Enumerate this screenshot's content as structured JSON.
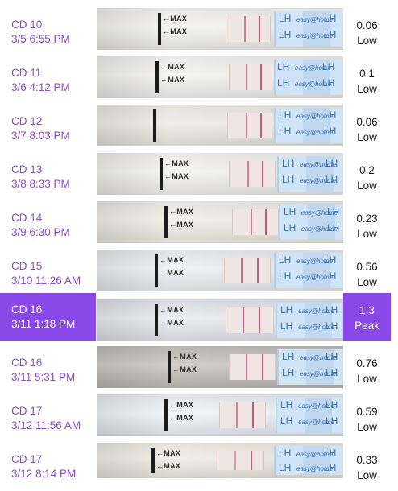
{
  "strip_text": {
    "max": "←MAX",
    "lh": "LH",
    "brand": "easy@home"
  },
  "colors": {
    "label": "#8a4fc4",
    "peak_highlight": "#8a48e8",
    "value": "#1d1d1d"
  },
  "readings": [
    {
      "cd": "CD 10",
      "datetime": "3/5 6:55 PM",
      "value": "0.06",
      "level": "Low"
    },
    {
      "cd": "CD 11",
      "datetime": "3/6 4:12 PM",
      "value": "0.1",
      "level": "Low"
    },
    {
      "cd": "CD 12",
      "datetime": "3/7 8:03 PM",
      "value": "0.06",
      "level": "Low"
    },
    {
      "cd": "CD 13",
      "datetime": "3/8 8:33 PM",
      "value": "0.2",
      "level": "Low"
    },
    {
      "cd": "CD 14",
      "datetime": "3/9 6:30 PM",
      "value": "0.23",
      "level": "Low"
    },
    {
      "cd": "CD 15",
      "datetime": "3/10 11:26 AM",
      "value": "0.56",
      "level": "Low"
    },
    {
      "cd": "CD 16",
      "datetime": "3/11 1:18 PM",
      "value": "1.3",
      "level": "Peak"
    },
    {
      "cd": "CD 16",
      "datetime": "3/11 5:31 PM",
      "value": "0.76",
      "level": "Low"
    },
    {
      "cd": "CD 17",
      "datetime": "3/12 11:56 AM",
      "value": "0.59",
      "level": "Low"
    },
    {
      "cd": "CD 17",
      "datetime": "3/12 8:14 PM",
      "value": "0.33",
      "level": "Low"
    }
  ]
}
